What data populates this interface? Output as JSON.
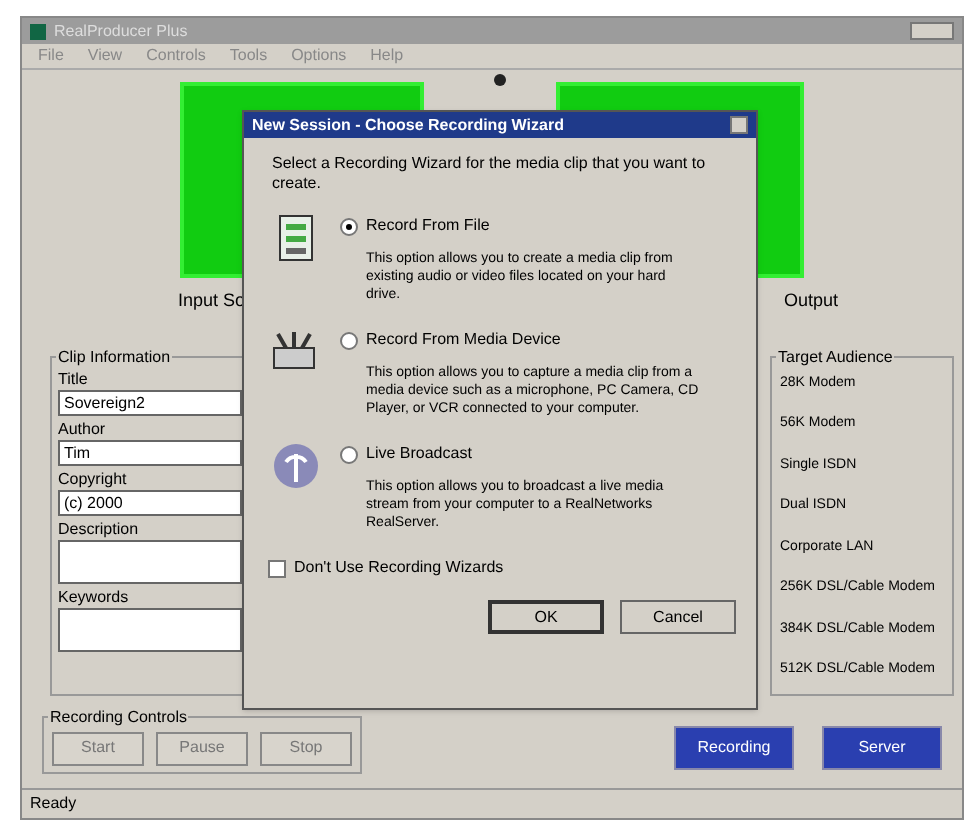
{
  "window": {
    "title": "RealProducer Plus"
  },
  "menu": [
    "File",
    "View",
    "Controls",
    "Tools",
    "Options",
    "Help"
  ],
  "panels": {
    "input_caption": "Input So",
    "output_caption": "Output"
  },
  "clip_information": {
    "label": "Clip Information",
    "fields": [
      {
        "label": "Title",
        "value": "Sovereign2"
      },
      {
        "label": "Author",
        "value": "Tim"
      },
      {
        "label": "Copyright",
        "value": "(c) 2000"
      },
      {
        "label": "Description"
      },
      {
        "label": "Keywords"
      }
    ]
  },
  "recording_controls": {
    "label": "Recording Controls",
    "buttons": [
      {
        "label": "Start",
        "disabled": true
      },
      {
        "label": "Pause",
        "disabled": true
      },
      {
        "label": "Stop",
        "disabled": true
      }
    ]
  },
  "target_audience": {
    "label": "Target Audience",
    "items": [
      "28K Modem",
      "56K Modem",
      "Single ISDN",
      "Dual ISDN",
      "Corporate LAN",
      "256K DSL/Cable Modem",
      "384K DSL/Cable Modem",
      "512K DSL/Cable Modem"
    ]
  },
  "action_buttons": [
    "Recording",
    "Server"
  ],
  "status_bar": "Ready",
  "dialog": {
    "title": "New Session - Choose Recording Wizard",
    "intro": "Select a Recording Wizard for the media clip that you want to create.",
    "options": [
      {
        "kind": "file",
        "label": "Record From File",
        "selected": true,
        "description": "This option allows you to create a media clip from existing audio or video files located on your hard drive."
      },
      {
        "kind": "device",
        "label": "Record From Media Device",
        "selected": false,
        "description": "This option allows you to capture a media clip from a media device such as a microphone, PC Camera, CD Player, or VCR connected to your computer."
      },
      {
        "kind": "broadcast",
        "label": "Live Broadcast",
        "selected": false,
        "description": "This option allows you to broadcast a live media stream from your computer to a RealNetworks RealServer."
      }
    ],
    "checkbox": {
      "label": "Don't Use Recording Wizards",
      "checked": false
    },
    "buttons": [
      "OK",
      "Cancel"
    ]
  }
}
